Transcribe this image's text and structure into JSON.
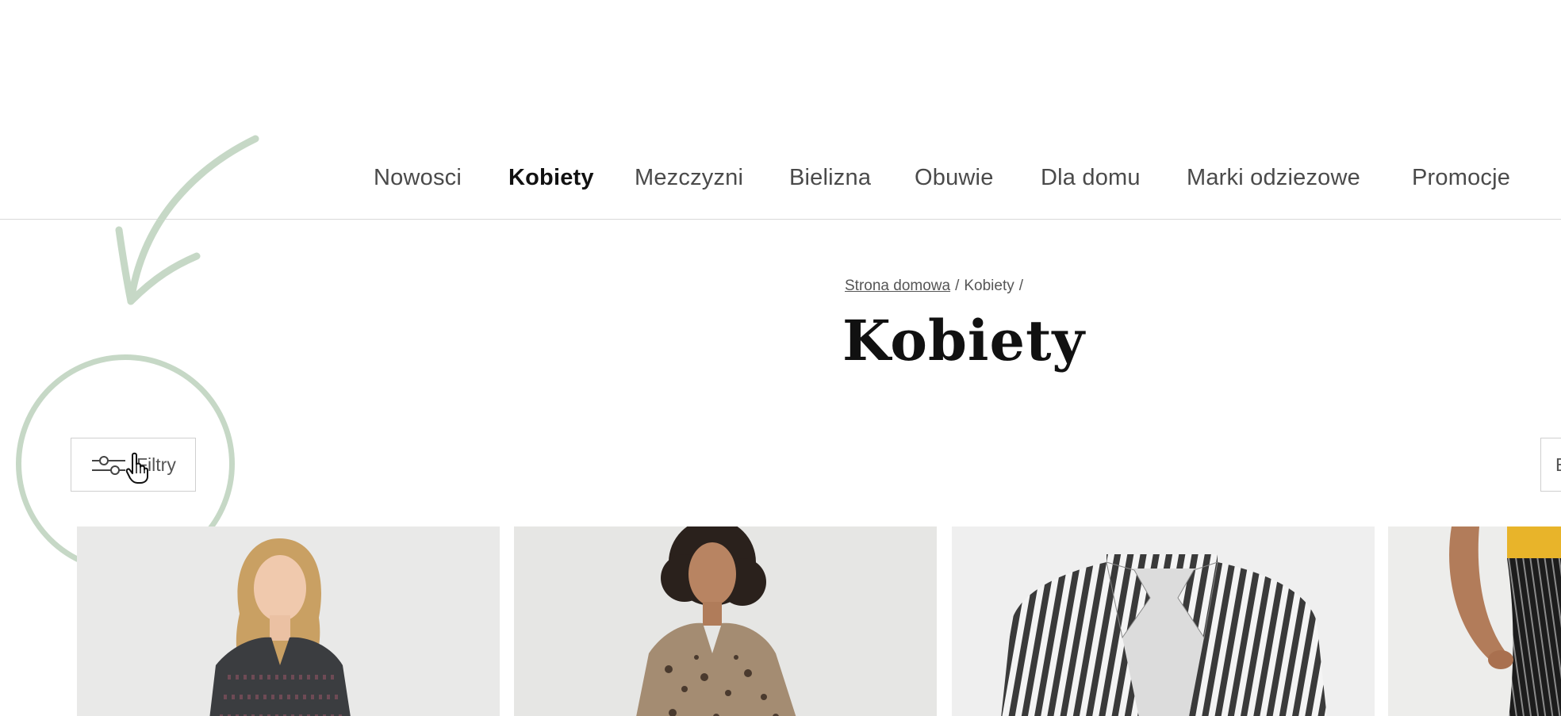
{
  "nav": {
    "items": [
      {
        "label": "Nowosci",
        "active": false
      },
      {
        "label": "Kobiety",
        "active": true
      },
      {
        "label": "Mezczyzni",
        "active": false
      },
      {
        "label": "Bielizna",
        "active": false
      },
      {
        "label": "Obuwie",
        "active": false
      },
      {
        "label": "Dla domu",
        "active": false
      },
      {
        "label": "Marki odziezowe",
        "active": false
      },
      {
        "label": "Promocje",
        "active": false
      }
    ]
  },
  "breadcrumb": {
    "home": "Strona domowa",
    "current": "Kobiety",
    "separator": "/"
  },
  "page": {
    "title": "Kobiety"
  },
  "toolbar": {
    "filters_label": "Filtry",
    "filters_icon": "sliders-icon",
    "sort_label_partial": "E"
  },
  "annotation": {
    "color": "#c6d8c6"
  },
  "products": [
    {
      "image": "woman-blonde-knit-sweater"
    },
    {
      "image": "woman-leopard-print-blouse"
    },
    {
      "image": "striped-blazer"
    },
    {
      "image": "pinstripe-trousers-yellow-top"
    }
  ]
}
